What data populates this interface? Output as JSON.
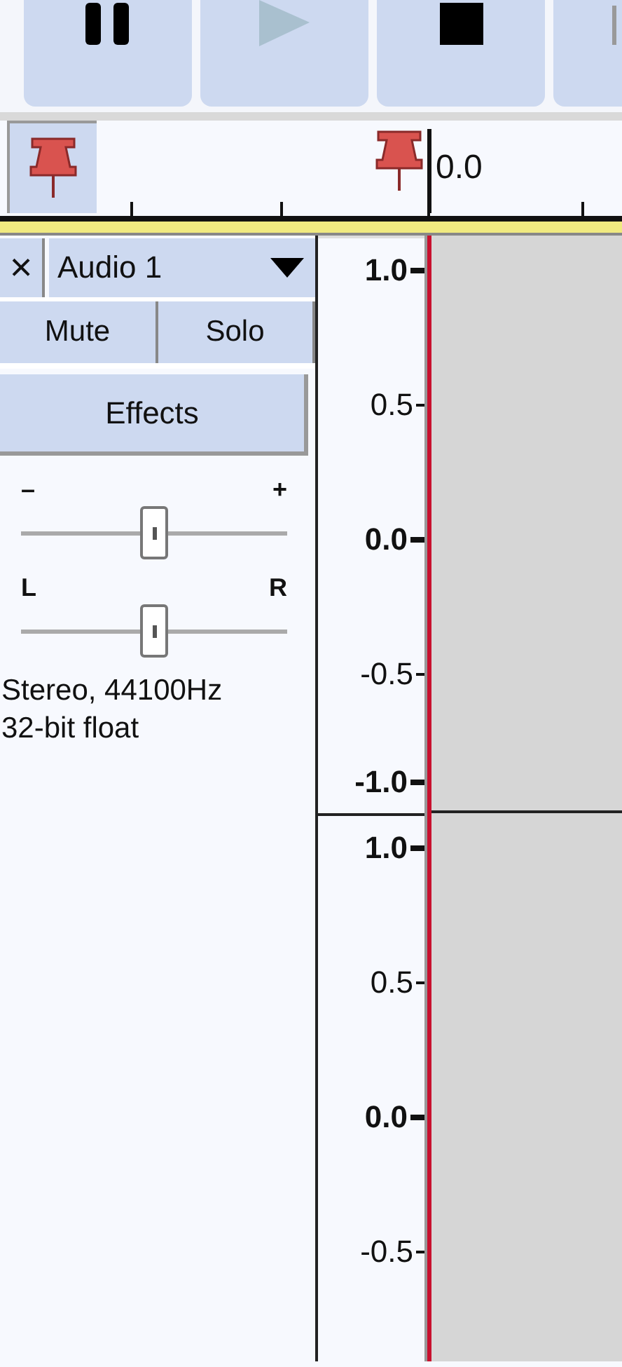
{
  "transport": [
    {
      "kind": "pause",
      "disabled": false
    },
    {
      "kind": "play",
      "disabled": true
    },
    {
      "kind": "stop",
      "disabled": false
    },
    {
      "kind": "skip-start",
      "disabled": false
    }
  ],
  "timeline": {
    "label": "0.0"
  },
  "track": {
    "name": "Audio 1",
    "close": "×",
    "buttons": [
      {
        "label": "Mute",
        "selected": false
      },
      {
        "label": "Solo",
        "selected": false
      }
    ],
    "effects": "Effects",
    "gain": {
      "min_label": "–",
      "max_label": "+",
      "level": 0.5
    },
    "pan": {
      "min_label": "L",
      "max_label": "R",
      "level": 0.5
    },
    "info": [
      "Stereo, 44100Hz",
      "32-bit float"
    ],
    "channels": [
      {
        "labels": [
          {
            "text": "1.0",
            "kind": "major"
          },
          {
            "text": "0.5",
            "kind": "minor"
          },
          {
            "text": "0.0",
            "kind": "major"
          },
          {
            "text": "-0.5",
            "kind": "minor"
          },
          {
            "text": "-1.0",
            "kind": "major"
          }
        ]
      },
      {
        "labels": [
          {
            "text": "1.0",
            "kind": "major"
          },
          {
            "text": "0.5",
            "kind": "minor"
          },
          {
            "text": "0.0",
            "kind": "major"
          },
          {
            "text": "-0.5",
            "kind": "minor"
          }
        ]
      }
    ]
  }
}
